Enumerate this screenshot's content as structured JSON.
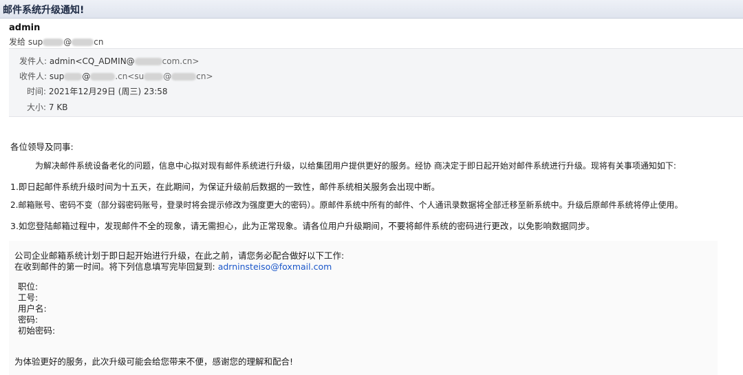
{
  "window": {
    "title": "邮件系统升级通知!"
  },
  "message": {
    "sender_display": "admin",
    "to_prefix": "发给 sup",
    "to_at": "@",
    "to_suffix": "cn"
  },
  "header": {
    "from_label": "发件人:",
    "from_value": "admin<CQ_ADMIN@",
    "from_suffix": "com.cn>",
    "to_label": "收件人:",
    "to_value1_a": "sup",
    "to_value1_b": "@",
    "to_value1_c": ".cn<su",
    "to_value2_b": "@",
    "to_value2_c": "cn>",
    "time_label": "时间:",
    "time_value": "2021年12月29日 (周三) 23:58",
    "size_label": "大小:",
    "size_value": "7 KB"
  },
  "body": {
    "greeting": "各位领导及同事:",
    "intro": "为解决邮件系统设备老化的问题，信息中心拟对现有邮件系统进行升级，以给集团用户提供更好的服务。经协    商决定于即日起开始对邮件系统进行升级。现将有关事项通知如下:",
    "item1": "1.即日起邮件系统升级时间为十五天，在此期间，为保证升级前后数据的一致性，邮件系统相关服务会出现中断。",
    "item2": "2.邮箱账号、密码不变（部分弱密码账号，登录时将会提示修改为强度更大的密码）。原邮件系统中所有的邮件、个人通讯录数据将全部迁移至新系统中。升级后原邮件系统将停止使用。",
    "item3": "3.如您登陆邮箱过程中，发现邮件不全的现象，请无需担心，此为正常现象。请各位用户升级期间，不要将邮件系统的密码进行更改，以免影响数据同步。"
  },
  "notice": {
    "line1": "公司企业邮箱系统计划于即日起开始进行升级，在此之前，请您务必配合做好以下工作:",
    "line2": "在收到邮件的第一时间。将下列信息填写完毕回复到:",
    "reply_email": "adrninsteiso@foxmail.com",
    "fields": [
      "职位:",
      "工号:",
      "用户名:",
      "密码:",
      "初始密码:"
    ],
    "closing": "为体验更好的服务，此次升级可能会给您带来不便，感谢您的理解和配合!"
  }
}
